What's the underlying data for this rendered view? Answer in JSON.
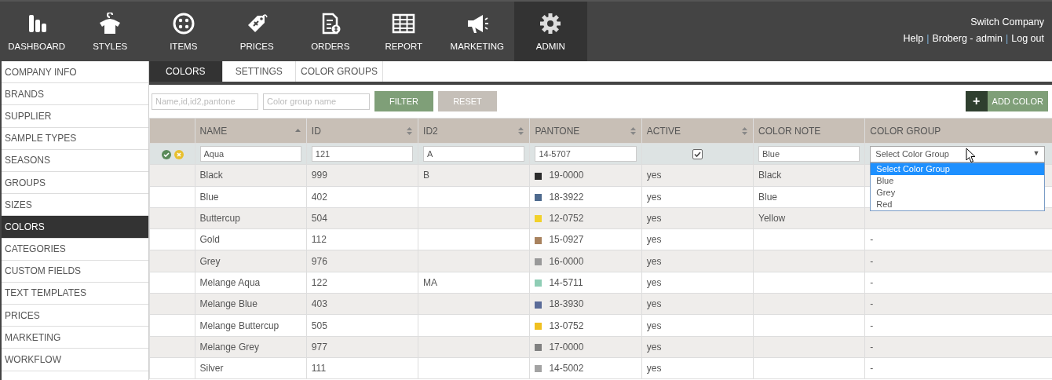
{
  "top_nav": {
    "items": [
      {
        "label": "DASHBOARD",
        "kind": "dashboard",
        "selected": false
      },
      {
        "label": "STYLES",
        "kind": "styles",
        "selected": false
      },
      {
        "label": "ITEMS",
        "kind": "items",
        "selected": false
      },
      {
        "label": "PRICES",
        "kind": "prices",
        "selected": false
      },
      {
        "label": "ORDERS",
        "kind": "orders",
        "selected": false
      },
      {
        "label": "REPORT",
        "kind": "report",
        "selected": false
      },
      {
        "label": "MARKETING",
        "kind": "marketing",
        "selected": false
      },
      {
        "label": "ADMIN",
        "kind": "admin",
        "selected": true
      }
    ],
    "account": {
      "switch": "Switch Company",
      "links": [
        {
          "kind": "link",
          "text": "Help"
        },
        {
          "kind": "separator",
          "text": "|"
        },
        {
          "kind": "link",
          "text": "Broberg - admin"
        },
        {
          "kind": "separator",
          "text": "|"
        },
        {
          "kind": "link",
          "text": "Log out"
        }
      ]
    }
  },
  "sidebar": {
    "items": [
      {
        "label": "COMPANY INFO",
        "selected": false
      },
      {
        "label": "BRANDS",
        "selected": false
      },
      {
        "label": "SUPPLIER",
        "selected": false
      },
      {
        "label": "SAMPLE TYPES",
        "selected": false
      },
      {
        "label": "SEASONS",
        "selected": false
      },
      {
        "label": "GROUPS",
        "selected": false
      },
      {
        "label": "SIZES",
        "selected": false
      },
      {
        "label": "COLORS",
        "selected": true
      },
      {
        "label": "CATEGORIES",
        "selected": false
      },
      {
        "label": "CUSTOM FIELDS",
        "selected": false
      },
      {
        "label": "TEXT TEMPLATES",
        "selected": false
      },
      {
        "label": "PRICES",
        "selected": false
      },
      {
        "label": "MARKETING",
        "selected": false
      },
      {
        "label": "WORKFLOW",
        "selected": false
      }
    ]
  },
  "tabs": [
    {
      "label": "COLORS",
      "selected": true
    },
    {
      "label": "SETTINGS",
      "selected": false
    },
    {
      "label": "COLOR GROUPS",
      "selected": false
    }
  ],
  "filter": {
    "search_placeholder": "Name,id,id2,pantone",
    "group_placeholder": "Color group name",
    "filter_button": "FILTER",
    "reset_button": "RESET",
    "add_icon": "+",
    "add_button": "ADD COLOR"
  },
  "table": {
    "columns": [
      {
        "label": "NAME",
        "sortable": true,
        "sorted_ascending": true
      },
      {
        "label": "ID",
        "sortable": true,
        "sorted_ascending": false
      },
      {
        "label": "ID2",
        "sortable": true,
        "sorted_ascending": false
      },
      {
        "label": "PANTONE",
        "sortable": true,
        "sorted_ascending": false
      },
      {
        "label": "ACTIVE",
        "sortable": true,
        "sorted_ascending": false
      },
      {
        "label": "COLOR NOTE",
        "sortable": false
      },
      {
        "label": "COLOR GROUP",
        "sortable": false
      }
    ],
    "edit_row": {
      "name": "Aqua",
      "id": "121",
      "id2": "A",
      "pantone": "14-5707",
      "active": true,
      "color_note": "Blue",
      "color_group": "Select Color Group",
      "caret": "▼"
    },
    "dropdown": {
      "options": [
        {
          "label": "Select Color Group",
          "selected": true
        },
        {
          "label": "Blue",
          "selected": false
        },
        {
          "label": "Grey",
          "selected": false
        },
        {
          "label": "Red",
          "selected": false
        }
      ]
    },
    "rows": [
      {
        "name": "Black",
        "id": "999",
        "id2": "B",
        "pantone": "19-0000",
        "color": "#2b2b2b",
        "active": "yes",
        "color_note": "Black"
      },
      {
        "name": "Blue",
        "id": "402",
        "pantone": "18-3922",
        "color": "#4e6a8e",
        "active": "yes",
        "color_note": "Blue"
      },
      {
        "name": "Buttercup",
        "id": "504",
        "pantone": "12-0752",
        "color": "#f2d12a",
        "active": "yes",
        "color_note": "Yellow"
      },
      {
        "name": "Gold",
        "id": "112",
        "pantone": "15-0927",
        "color": "#a8825e",
        "active": "yes",
        "color_group": "-"
      },
      {
        "name": "Grey",
        "id": "976",
        "pantone": "16-0000",
        "color": "#999999",
        "active": "yes",
        "color_group": "-"
      },
      {
        "name": "Melange Aqua",
        "id": "122",
        "id2": "MA",
        "pantone": "14-5711",
        "color": "#8fcdb5",
        "active": "yes",
        "color_group": "-"
      },
      {
        "name": "Melange Blue",
        "id": "403",
        "pantone": "18-3930",
        "color": "#5a6b98",
        "active": "yes",
        "color_group": "-"
      },
      {
        "name": "Melange Buttercup",
        "id": "505",
        "pantone": "13-0752",
        "color": "#f0c020",
        "active": "yes",
        "color_group": "-"
      },
      {
        "name": "Melange Grey",
        "id": "977",
        "pantone": "17-0000",
        "color": "#808080",
        "active": "yes",
        "color_group": "-"
      },
      {
        "name": "Silver",
        "id": "111",
        "pantone": "14-5002",
        "color": "#a3a3a3",
        "active": "yes",
        "color_group": "-"
      }
    ]
  }
}
